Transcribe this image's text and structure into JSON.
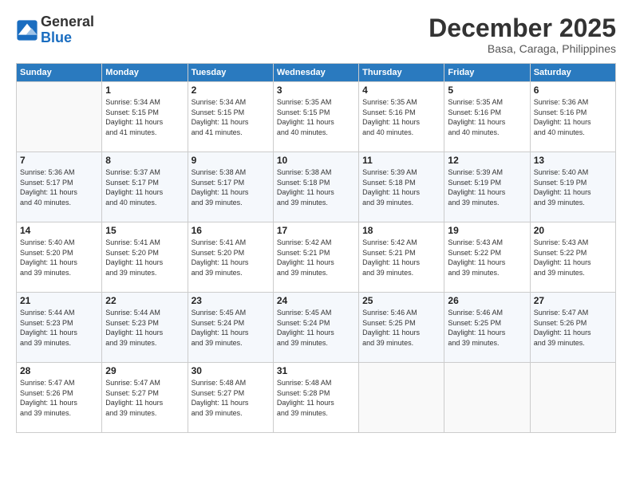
{
  "logo": {
    "text_general": "General",
    "text_blue": "Blue"
  },
  "header": {
    "month": "December 2025",
    "location": "Basa, Caraga, Philippines"
  },
  "weekdays": [
    "Sunday",
    "Monday",
    "Tuesday",
    "Wednesday",
    "Thursday",
    "Friday",
    "Saturday"
  ],
  "weeks": [
    [
      {
        "day": "",
        "info": ""
      },
      {
        "day": "1",
        "info": "Sunrise: 5:34 AM\nSunset: 5:15 PM\nDaylight: 11 hours\nand 41 minutes."
      },
      {
        "day": "2",
        "info": "Sunrise: 5:34 AM\nSunset: 5:15 PM\nDaylight: 11 hours\nand 41 minutes."
      },
      {
        "day": "3",
        "info": "Sunrise: 5:35 AM\nSunset: 5:15 PM\nDaylight: 11 hours\nand 40 minutes."
      },
      {
        "day": "4",
        "info": "Sunrise: 5:35 AM\nSunset: 5:16 PM\nDaylight: 11 hours\nand 40 minutes."
      },
      {
        "day": "5",
        "info": "Sunrise: 5:35 AM\nSunset: 5:16 PM\nDaylight: 11 hours\nand 40 minutes."
      },
      {
        "day": "6",
        "info": "Sunrise: 5:36 AM\nSunset: 5:16 PM\nDaylight: 11 hours\nand 40 minutes."
      }
    ],
    [
      {
        "day": "7",
        "info": "Sunrise: 5:36 AM\nSunset: 5:17 PM\nDaylight: 11 hours\nand 40 minutes."
      },
      {
        "day": "8",
        "info": "Sunrise: 5:37 AM\nSunset: 5:17 PM\nDaylight: 11 hours\nand 40 minutes."
      },
      {
        "day": "9",
        "info": "Sunrise: 5:38 AM\nSunset: 5:17 PM\nDaylight: 11 hours\nand 39 minutes."
      },
      {
        "day": "10",
        "info": "Sunrise: 5:38 AM\nSunset: 5:18 PM\nDaylight: 11 hours\nand 39 minutes."
      },
      {
        "day": "11",
        "info": "Sunrise: 5:39 AM\nSunset: 5:18 PM\nDaylight: 11 hours\nand 39 minutes."
      },
      {
        "day": "12",
        "info": "Sunrise: 5:39 AM\nSunset: 5:19 PM\nDaylight: 11 hours\nand 39 minutes."
      },
      {
        "day": "13",
        "info": "Sunrise: 5:40 AM\nSunset: 5:19 PM\nDaylight: 11 hours\nand 39 minutes."
      }
    ],
    [
      {
        "day": "14",
        "info": "Sunrise: 5:40 AM\nSunset: 5:20 PM\nDaylight: 11 hours\nand 39 minutes."
      },
      {
        "day": "15",
        "info": "Sunrise: 5:41 AM\nSunset: 5:20 PM\nDaylight: 11 hours\nand 39 minutes."
      },
      {
        "day": "16",
        "info": "Sunrise: 5:41 AM\nSunset: 5:20 PM\nDaylight: 11 hours\nand 39 minutes."
      },
      {
        "day": "17",
        "info": "Sunrise: 5:42 AM\nSunset: 5:21 PM\nDaylight: 11 hours\nand 39 minutes."
      },
      {
        "day": "18",
        "info": "Sunrise: 5:42 AM\nSunset: 5:21 PM\nDaylight: 11 hours\nand 39 minutes."
      },
      {
        "day": "19",
        "info": "Sunrise: 5:43 AM\nSunset: 5:22 PM\nDaylight: 11 hours\nand 39 minutes."
      },
      {
        "day": "20",
        "info": "Sunrise: 5:43 AM\nSunset: 5:22 PM\nDaylight: 11 hours\nand 39 minutes."
      }
    ],
    [
      {
        "day": "21",
        "info": "Sunrise: 5:44 AM\nSunset: 5:23 PM\nDaylight: 11 hours\nand 39 minutes."
      },
      {
        "day": "22",
        "info": "Sunrise: 5:44 AM\nSunset: 5:23 PM\nDaylight: 11 hours\nand 39 minutes."
      },
      {
        "day": "23",
        "info": "Sunrise: 5:45 AM\nSunset: 5:24 PM\nDaylight: 11 hours\nand 39 minutes."
      },
      {
        "day": "24",
        "info": "Sunrise: 5:45 AM\nSunset: 5:24 PM\nDaylight: 11 hours\nand 39 minutes."
      },
      {
        "day": "25",
        "info": "Sunrise: 5:46 AM\nSunset: 5:25 PM\nDaylight: 11 hours\nand 39 minutes."
      },
      {
        "day": "26",
        "info": "Sunrise: 5:46 AM\nSunset: 5:25 PM\nDaylight: 11 hours\nand 39 minutes."
      },
      {
        "day": "27",
        "info": "Sunrise: 5:47 AM\nSunset: 5:26 PM\nDaylight: 11 hours\nand 39 minutes."
      }
    ],
    [
      {
        "day": "28",
        "info": "Sunrise: 5:47 AM\nSunset: 5:26 PM\nDaylight: 11 hours\nand 39 minutes."
      },
      {
        "day": "29",
        "info": "Sunrise: 5:47 AM\nSunset: 5:27 PM\nDaylight: 11 hours\nand 39 minutes."
      },
      {
        "day": "30",
        "info": "Sunrise: 5:48 AM\nSunset: 5:27 PM\nDaylight: 11 hours\nand 39 minutes."
      },
      {
        "day": "31",
        "info": "Sunrise: 5:48 AM\nSunset: 5:28 PM\nDaylight: 11 hours\nand 39 minutes."
      },
      {
        "day": "",
        "info": ""
      },
      {
        "day": "",
        "info": ""
      },
      {
        "day": "",
        "info": ""
      }
    ]
  ]
}
